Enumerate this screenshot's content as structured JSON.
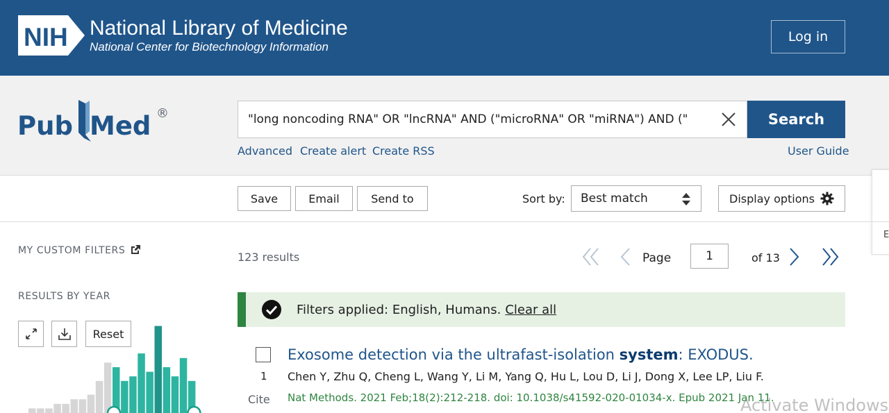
{
  "nih": {
    "logo_text": "NIH",
    "title": "National Library of Medicine",
    "subtitle": "National Center for Biotechnology Information",
    "login_label": "Log in"
  },
  "search": {
    "logo_text_left": "Pub",
    "logo_text_right": "Med",
    "logo_registered": "®",
    "query": "\"long noncoding RNA\" OR \"lncRNA\" AND (\"microRNA\" OR \"miRNA\") AND (\"",
    "button_label": "Search",
    "links": [
      "Advanced",
      "Create alert",
      "Create RSS"
    ],
    "user_guide": "User Guide"
  },
  "toolbar": {
    "save_label": "Save",
    "email_label": "Email",
    "send_label": "Send to",
    "sort_label": "Sort by:",
    "sort_value": "Best match",
    "display_label": "Display options",
    "side_tab_letter": "E"
  },
  "sidebar": {
    "custom_filters": "MY CUSTOM FILTERS",
    "results_by_year": "RESULTS BY YEAR",
    "reset_label": "Reset"
  },
  "results": {
    "count": "123 results",
    "page_label": "Page",
    "page_value": "1",
    "page_of": "of 13",
    "filters_applied": "Filters applied: English, Humans.",
    "clear_all": "Clear all",
    "items": [
      {
        "number": "1",
        "cite": "Cite",
        "title_pre": "Exosome detection via the ultrafast-isolation ",
        "title_bold": "system",
        "title_post": ": EXODUS.",
        "authors": "Chen Y, Zhu Q, Cheng L, Wang Y, Li M, Yang Q, Hu L, Lou D, Li J, Dong X, Lee LP, Liu F.",
        "citation": "Nat Methods. 2021 Feb;18(2):212-218. doi: 10.1038/s41592-020-01034-x. Epub 2021 Jan 11."
      }
    ]
  },
  "watermark": "Activate Windows",
  "chart_data": {
    "type": "bar",
    "values": [
      1,
      1,
      1,
      2,
      2,
      3,
      3,
      4,
      7,
      11,
      10,
      7,
      8,
      13,
      9,
      19,
      10,
      8,
      12,
      7
    ],
    "highlight_from_index": 10,
    "colors": {
      "base": "#d6d6d6",
      "selected": "#2eb5a1",
      "selected_dark": "#20948a",
      "handle": "#1a9e8a"
    }
  },
  "colors": {
    "nih_blue": "#20558a",
    "link_blue": "#20558a",
    "green": "#2e8540",
    "filter_bg": "#e6f1e4"
  }
}
